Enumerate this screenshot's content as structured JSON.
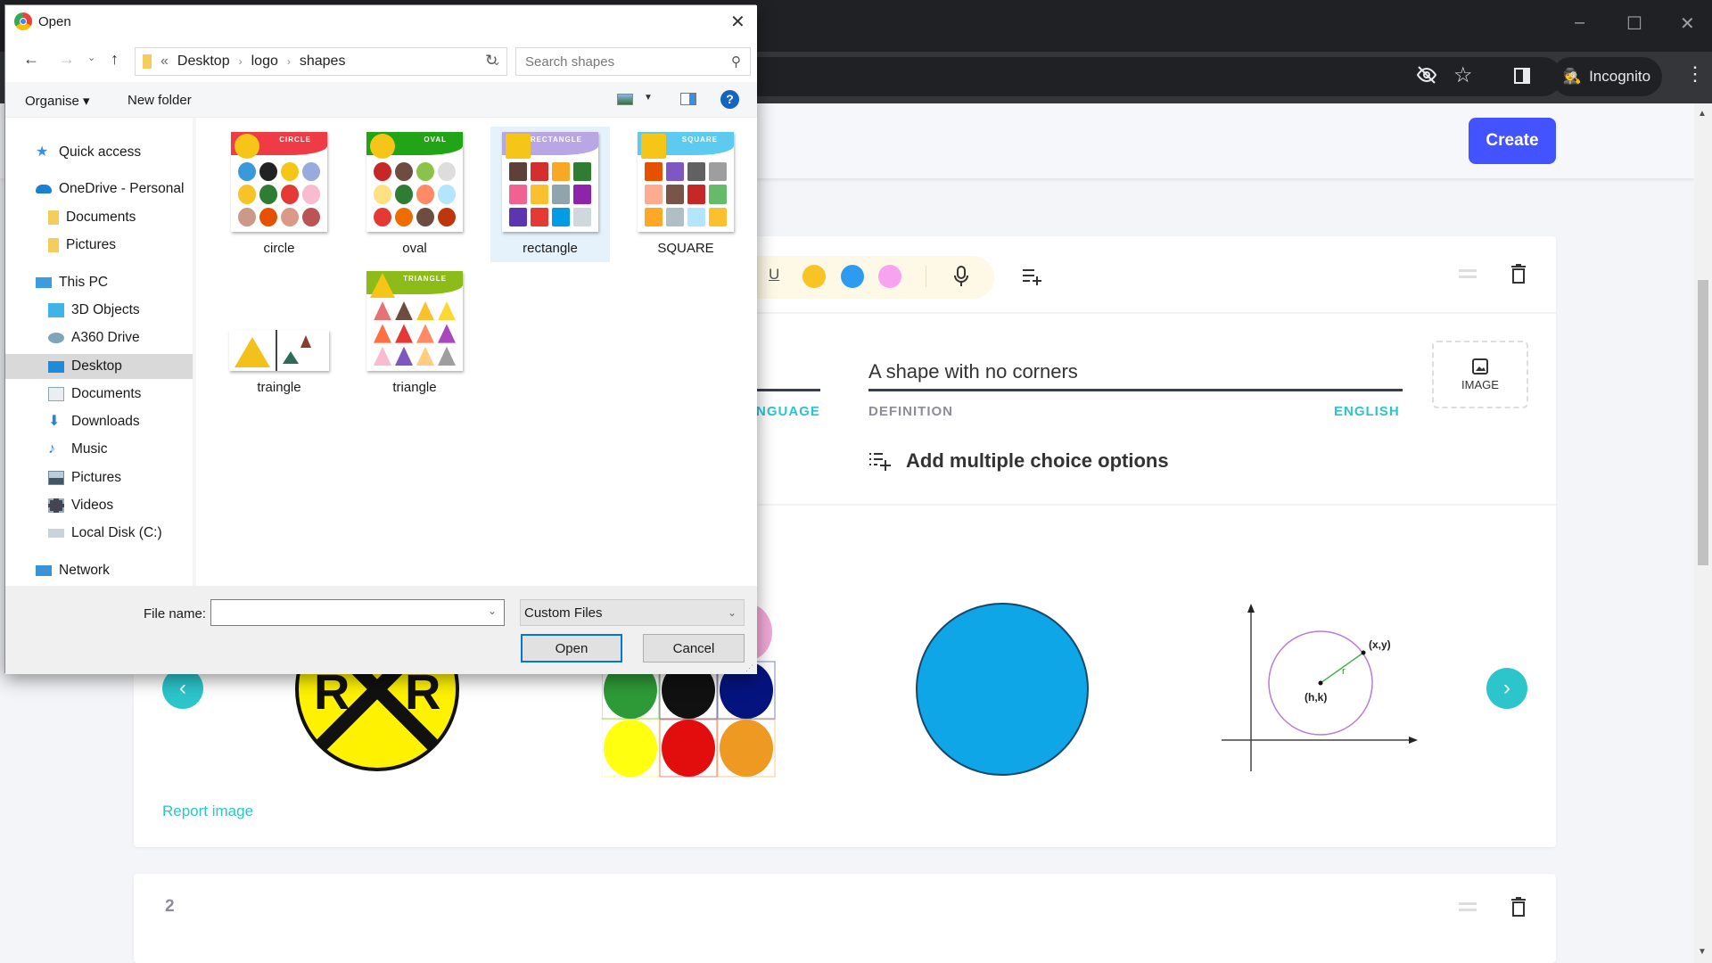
{
  "browser": {
    "incognito_label": "Incognito",
    "icons": [
      "eye-off-icon",
      "star-icon",
      "side-panel-icon",
      "incognito-icon",
      "menu-icon"
    ],
    "window_controls": {
      "minimize": "–",
      "maximize": "☐",
      "close": "✕"
    }
  },
  "page": {
    "create_label": "Create",
    "card1": {
      "format_colors": [
        "#f7c325",
        "#2d9cf0",
        "#f8a3f0"
      ],
      "underline_label": "U",
      "definition_text": "A shape with no corners",
      "language_label": "NGUAGE",
      "definition_label": "DEFINITION",
      "english_label": "ENGLISH",
      "image_label": "IMAGE",
      "add_mc_label": "Add multiple choice options",
      "report_label": "Report image",
      "diagram_labels": {
        "point": "(x,y)",
        "center": "(h,k)",
        "radius": "r"
      },
      "color_dots": [
        "#2e9a37",
        "#111111",
        "#05137f",
        "#ffff10",
        "#e20e0e",
        "#ee9a22"
      ],
      "accent": "#2bc5cb"
    },
    "card2": {
      "number": "2"
    }
  },
  "dialog": {
    "title": "Open",
    "breadcrumb": {
      "prefix": "«",
      "items": [
        "Desktop",
        "logo",
        "shapes"
      ]
    },
    "search_placeholder": "Search shapes",
    "organise_label": "Organise ▾",
    "new_folder_label": "New folder",
    "nav": [
      {
        "label": "Quick access",
        "icon": "star-icon",
        "indent": 0
      },
      {
        "label": "OneDrive - Personal",
        "icon": "cloud-icon",
        "indent": 0
      },
      {
        "label": "Documents",
        "icon": "folder-icon",
        "indent": 1
      },
      {
        "label": "Pictures",
        "icon": "folder-icon",
        "indent": 1
      },
      {
        "label": "This PC",
        "icon": "computer-icon",
        "indent": 0
      },
      {
        "label": "3D Objects",
        "icon": "cube-icon",
        "indent": 1
      },
      {
        "label": "A360 Drive",
        "icon": "drive-icon",
        "indent": 1
      },
      {
        "label": "Desktop",
        "icon": "desktop-icon",
        "indent": 1,
        "selected": true
      },
      {
        "label": "Documents",
        "icon": "document-icon",
        "indent": 1
      },
      {
        "label": "Downloads",
        "icon": "download-icon",
        "indent": 1
      },
      {
        "label": "Music",
        "icon": "music-icon",
        "indent": 1
      },
      {
        "label": "Pictures",
        "icon": "pictures-icon",
        "indent": 1
      },
      {
        "label": "Videos",
        "icon": "video-icon",
        "indent": 1
      },
      {
        "label": "Local Disk (C:)",
        "icon": "disk-icon",
        "indent": 1
      },
      {
        "label": "Network",
        "icon": "network-icon",
        "indent": 0
      }
    ],
    "files": [
      {
        "label": "circle",
        "banner": "CIRCLE",
        "color": "#ef3b45"
      },
      {
        "label": "oval",
        "banner": "OVAL",
        "color": "#21a516"
      },
      {
        "label": "rectangle",
        "banner": "RECTANGLE",
        "color": "#b9a6e4",
        "selected": true
      },
      {
        "label": "SQUARE",
        "banner": "SQUARE",
        "color": "#5ccbef"
      },
      {
        "label": "traingle",
        "banner": "",
        "color": "#f4c01b"
      },
      {
        "label": "triangle",
        "banner": "TRIANGLE",
        "color": "#8dbb1a"
      }
    ],
    "file_name_label": "File name:",
    "file_name_value": "",
    "file_type_value": "Custom Files",
    "open_label": "Open",
    "cancel_label": "Cancel"
  }
}
